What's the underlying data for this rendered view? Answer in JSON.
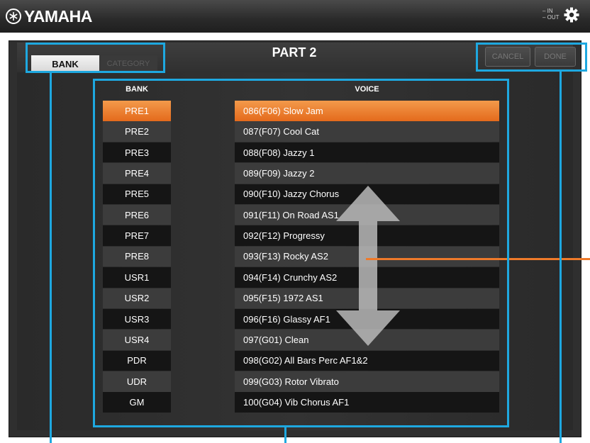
{
  "app": {
    "logo_text": "YAMAHA",
    "io_in": "IN",
    "io_out": "OUT"
  },
  "header": {
    "title": "PART 2",
    "tabs": {
      "bank": "BANK",
      "category": "CATEGORY"
    },
    "cancel_label": "CANCEL",
    "done_label": "DONE"
  },
  "columns": {
    "bank": "BANK",
    "voice": "VOICE"
  },
  "banks": [
    "PRE1",
    "PRE2",
    "PRE3",
    "PRE4",
    "PRE5",
    "PRE6",
    "PRE7",
    "PRE8",
    "USR1",
    "USR2",
    "USR3",
    "USR4",
    "PDR",
    "UDR",
    "GM"
  ],
  "selected_bank_index": 0,
  "voices": [
    "086(F06) Slow Jam",
    "087(F07) Cool Cat",
    "088(F08) Jazzy 1",
    "089(F09) Jazzy 2",
    "090(F10) Jazzy Chorus",
    "091(F11) On Road AS1",
    "092(F12) Progressy",
    "093(F13) Rocky AS2",
    "094(F14) Crunchy AS2",
    "095(F15) 1972 AS1",
    "096(F16) Glassy AF1",
    "097(G01) Clean",
    "098(G02) All Bars Perc AF1&2",
    "099(G03) Rotor Vibrato",
    "100(G04) Vib Chorus AF1"
  ],
  "selected_voice_index": 0,
  "colors": {
    "accent_orange": "#e8741f",
    "callout_blue": "#1ea8e0",
    "panel_dark": "#2f2f2f"
  },
  "icons": {
    "settings": "gear-icon",
    "logo": "yamaha-tuning-fork-icon",
    "scroll": "scroll-arrow-icon"
  }
}
